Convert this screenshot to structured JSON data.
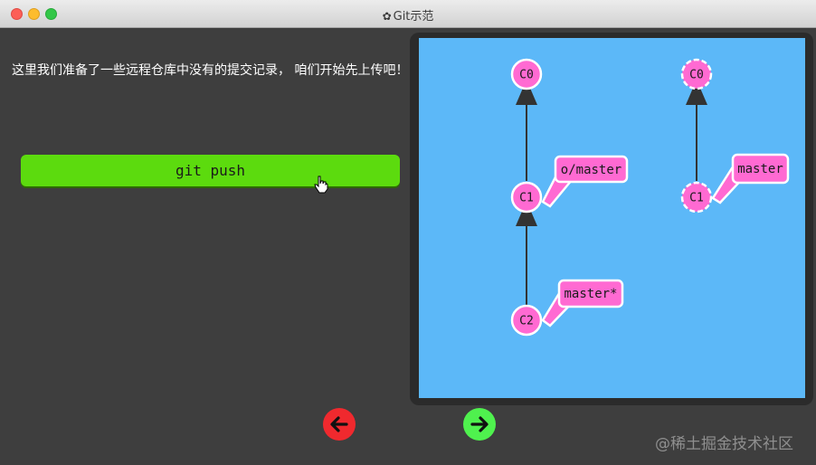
{
  "window": {
    "title": "Git示范",
    "title_icon": "gear-icon"
  },
  "description": "这里我们准备了一些远程仓库中没有的提交记录， 咱们开始先上传吧！",
  "command_button": {
    "label": "git push",
    "color": "#5cdb0e"
  },
  "local_repo": {
    "commits": [
      {
        "id": "C0"
      },
      {
        "id": "C1"
      },
      {
        "id": "C2"
      }
    ],
    "branches": [
      {
        "label": "o/master",
        "target": "C1"
      },
      {
        "label": "master*",
        "target": "C2"
      }
    ]
  },
  "remote_repo": {
    "commits": [
      {
        "id": "C0"
      },
      {
        "id": "C1"
      }
    ],
    "branches": [
      {
        "label": "master",
        "target": "C1"
      }
    ]
  },
  "colors": {
    "commit_fill": "#ff6ad2",
    "canvas_bg": "#5cb8f8",
    "back_button": "#f0292e",
    "forward_button": "#4ff14e"
  },
  "watermark": "@稀土掘金技术社区"
}
